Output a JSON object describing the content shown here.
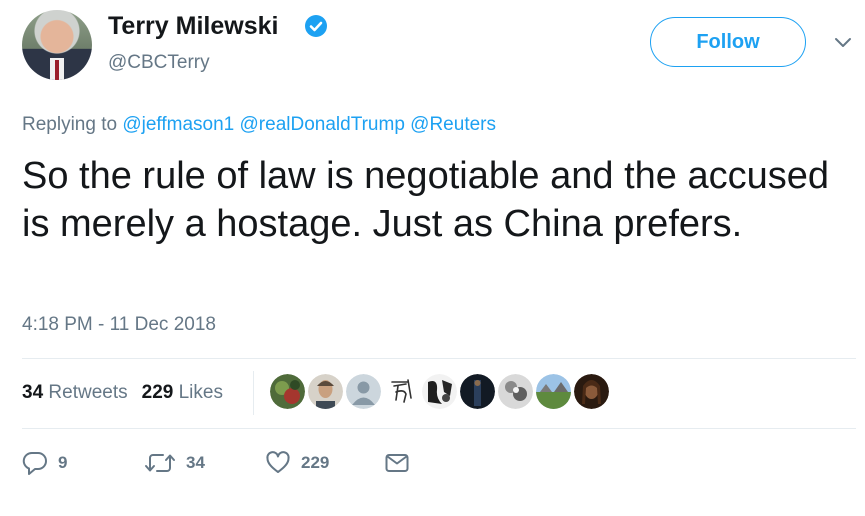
{
  "author": {
    "name": "Terry Milewski",
    "handle": "@CBCTerry",
    "verified": true,
    "avatar": "avatar-portrait"
  },
  "follow_button": {
    "label": "Follow"
  },
  "menu": {
    "icon": "chevron-down-icon"
  },
  "reply_context": {
    "prefix": "Replying to",
    "mentions": [
      "@jeffmason1",
      "@realDonaldTrump",
      "@Reuters"
    ]
  },
  "tweet": {
    "text": "So the rule of law is negotiable and the accused is merely a hostage. Just as China prefers.",
    "timestamp": "4:18 PM - 11 Dec 2018"
  },
  "stats": {
    "retweets_count": "34",
    "retweets_label": "Retweets",
    "likes_count": "229",
    "likes_label": "Likes"
  },
  "likers": [
    "liker-avatar-1",
    "liker-avatar-2",
    "liker-avatar-3",
    "liker-avatar-4",
    "liker-avatar-5",
    "liker-avatar-6",
    "liker-avatar-7",
    "liker-avatar-8",
    "liker-avatar-9"
  ],
  "actions": {
    "reply": {
      "icon": "reply-icon",
      "count": "9"
    },
    "retweet": {
      "icon": "retweet-icon",
      "count": "34"
    },
    "like": {
      "icon": "heart-icon",
      "count": "229"
    },
    "dm": {
      "icon": "envelope-icon"
    }
  },
  "colors": {
    "accent": "#1da1f2",
    "text": "#14171a",
    "muted": "#657786",
    "divider": "#e6ecf0"
  }
}
